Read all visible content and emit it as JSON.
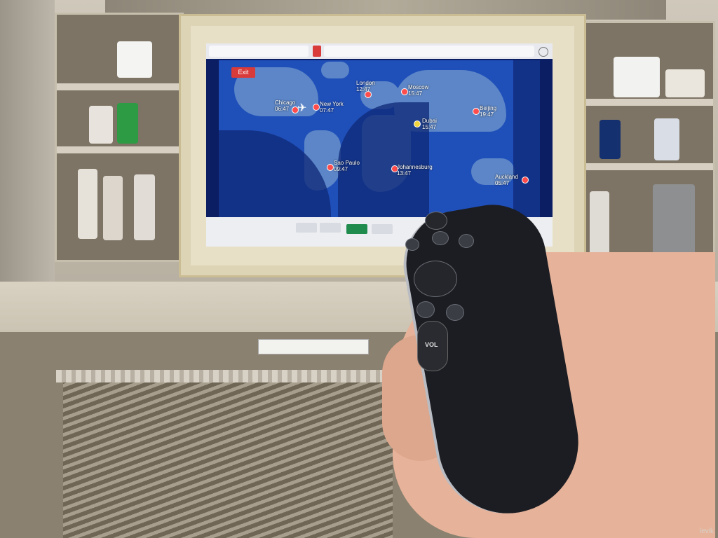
{
  "screen": {
    "exit_label": "Exit",
    "bottom_buttons": [
      "",
      "",
      "",
      "",
      ""
    ],
    "active_button_index": 3,
    "cities": [
      {
        "name": "Chicago",
        "time": "06:47"
      },
      {
        "name": "New York",
        "time": "07:47"
      },
      {
        "name": "London",
        "time": "12:47"
      },
      {
        "name": "Moscow",
        "time": "15:47"
      },
      {
        "name": "Dubai",
        "time": "15:47"
      },
      {
        "name": "Beijing",
        "time": "19:47"
      },
      {
        "name": "Sao Paulo",
        "time": "09:47"
      },
      {
        "name": "Johannesburg",
        "time": "13:47"
      },
      {
        "name": "Auckland",
        "time": "05:47"
      }
    ]
  },
  "remote": {
    "volume_label": "VOL"
  },
  "watermark": "levik",
  "colors": {
    "ocean": "#1f4fb9",
    "land": "#5c86c7",
    "night": "#0f2a79",
    "accent": "#d93a3a",
    "active_button": "#1f8c4d"
  }
}
